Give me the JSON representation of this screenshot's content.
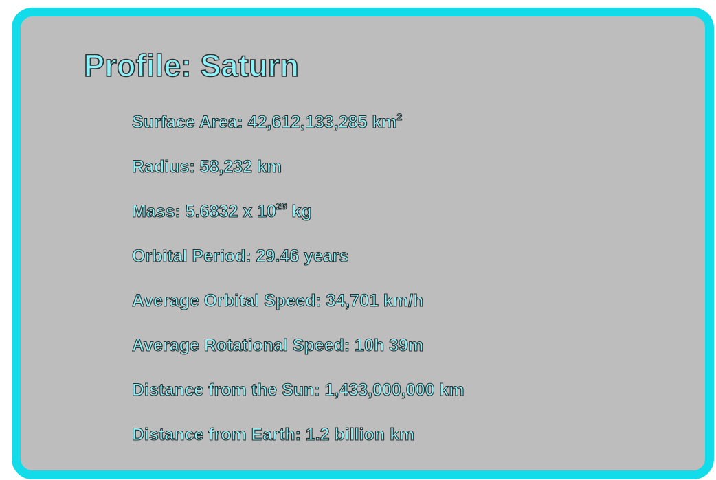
{
  "profile": {
    "title": "Profile: Saturn",
    "facts": [
      {
        "text": "Surface Area: 42,612,133,285 km",
        "sup": "2",
        "after": ""
      },
      {
        "text": "Radius: 58,232 km",
        "sup": "",
        "after": ""
      },
      {
        "text": "Mass: 5.6832 x 10",
        "sup": "26",
        "after": " kg"
      },
      {
        "text": "Orbital Period: 29.46 years",
        "sup": "",
        "after": ""
      },
      {
        "text": "Average Orbital Speed: 34,701 km/h",
        "sup": "",
        "after": ""
      },
      {
        "text": "Average Rotational Speed: 10h 39m",
        "sup": "",
        "after": ""
      },
      {
        "text": "Distance from the Sun: 1,433,000,000 km",
        "sup": "",
        "after": ""
      },
      {
        "text": "Distance from Earth: 1.2 billion km",
        "sup": "",
        "after": ""
      }
    ]
  },
  "colors": {
    "frame": "#12dbea",
    "panel": "#bdbdbd",
    "text_fill": "#8ef1f8",
    "text_outline": "#2e2e2e"
  }
}
